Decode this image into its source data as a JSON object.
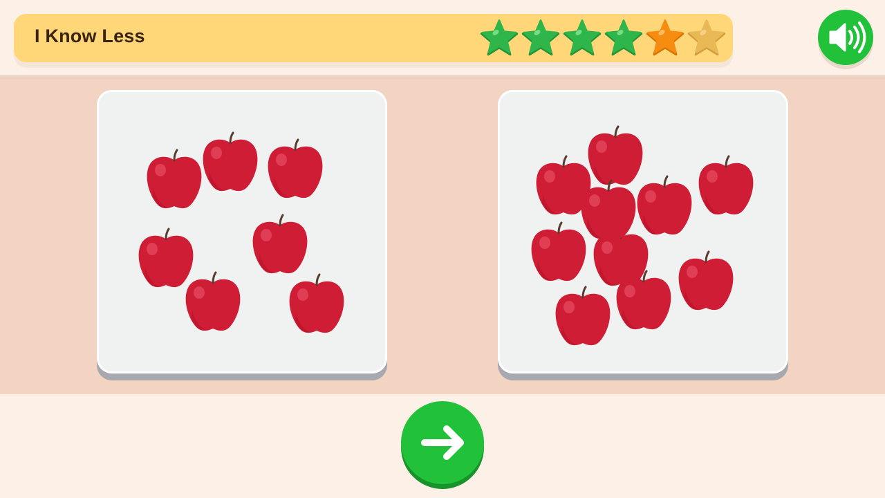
{
  "header": {
    "title": "I Know Less",
    "progress": {
      "total_stars": 6,
      "stars": [
        "complete",
        "complete",
        "complete",
        "complete",
        "current",
        "pending"
      ]
    }
  },
  "colors": {
    "header_bar": "#ffd778",
    "play_area": "#f3d4c2",
    "button_green": "#22c13a",
    "star_complete": "#2fb64a",
    "star_current": "#f78d10",
    "star_pending": "#e9b955",
    "apple": "#cf1d35"
  },
  "icons": {
    "sound": "speaker-volume-icon",
    "next": "arrow-right-icon",
    "star": "star-icon",
    "apple": "apple-icon"
  },
  "choices": [
    {
      "id": "left",
      "object": "apple",
      "count": 7
    },
    {
      "id": "right",
      "object": "apple",
      "count": 10
    }
  ]
}
